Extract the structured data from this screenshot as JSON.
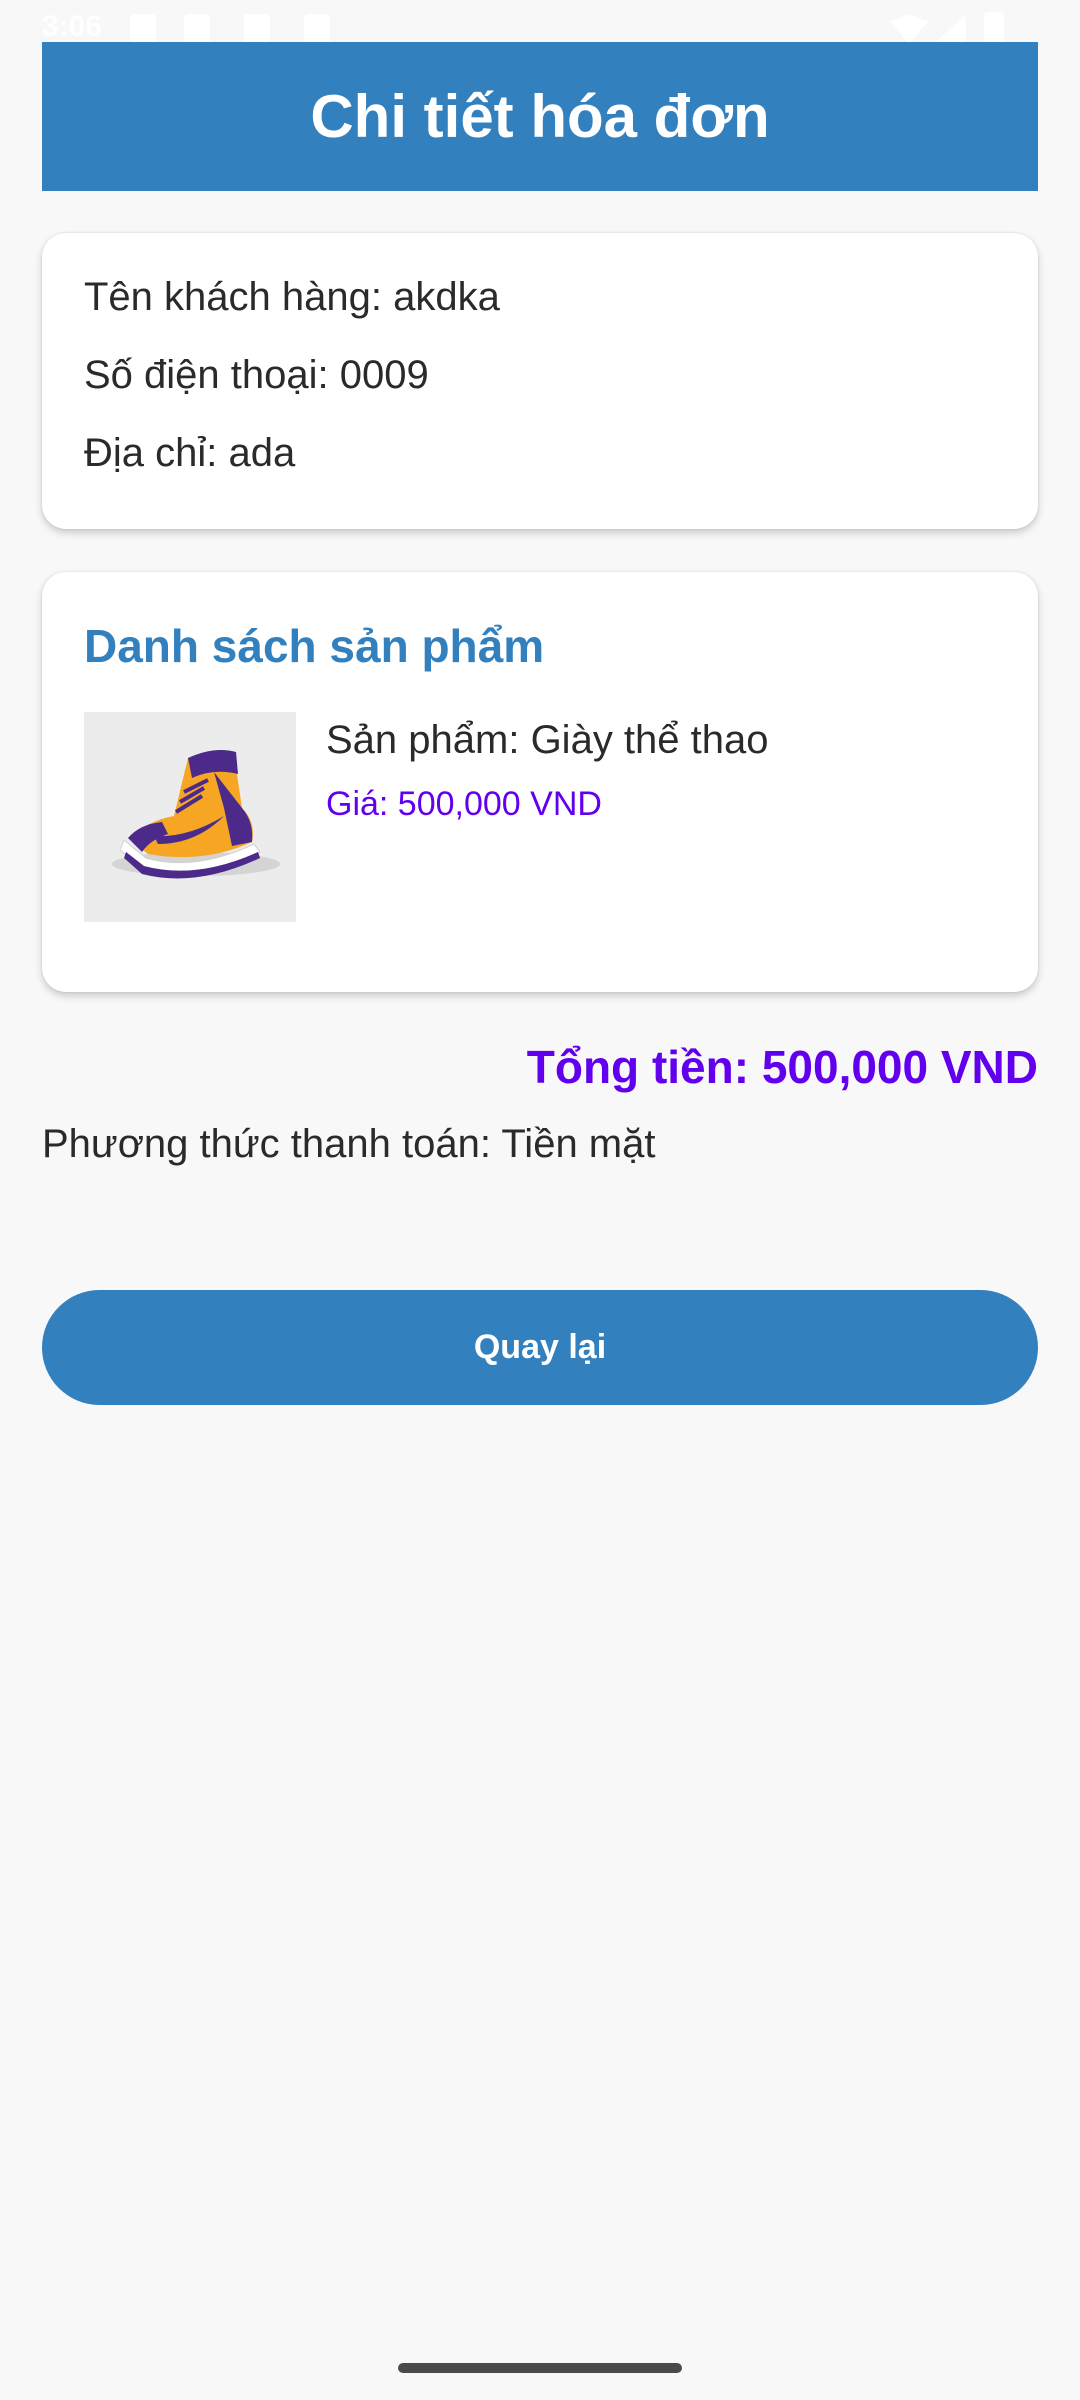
{
  "status_bar": {
    "time": "3:06"
  },
  "header": {
    "title": "Chi tiết hóa đơn",
    "color": "#3380bf"
  },
  "customer": {
    "name_line": "Tên khách hàng: akdka",
    "phone_line": "Số điện thoại: 0009",
    "address_line": "Địa chỉ: ada"
  },
  "products": {
    "section_title": "Danh sách sản phẩm",
    "items": [
      {
        "name_line": "Sản phẩm: Giày thể thao",
        "price_line": "Giá: 500,000 VND",
        "image_icon": "sneaker-image"
      }
    ]
  },
  "summary": {
    "total_line": "Tổng tiền: 500,000 VND",
    "payment_line": "Phương thức thanh toán: Tiền mặt",
    "accent_color": "#6200ee"
  },
  "actions": {
    "back_label": "Quay lại"
  }
}
